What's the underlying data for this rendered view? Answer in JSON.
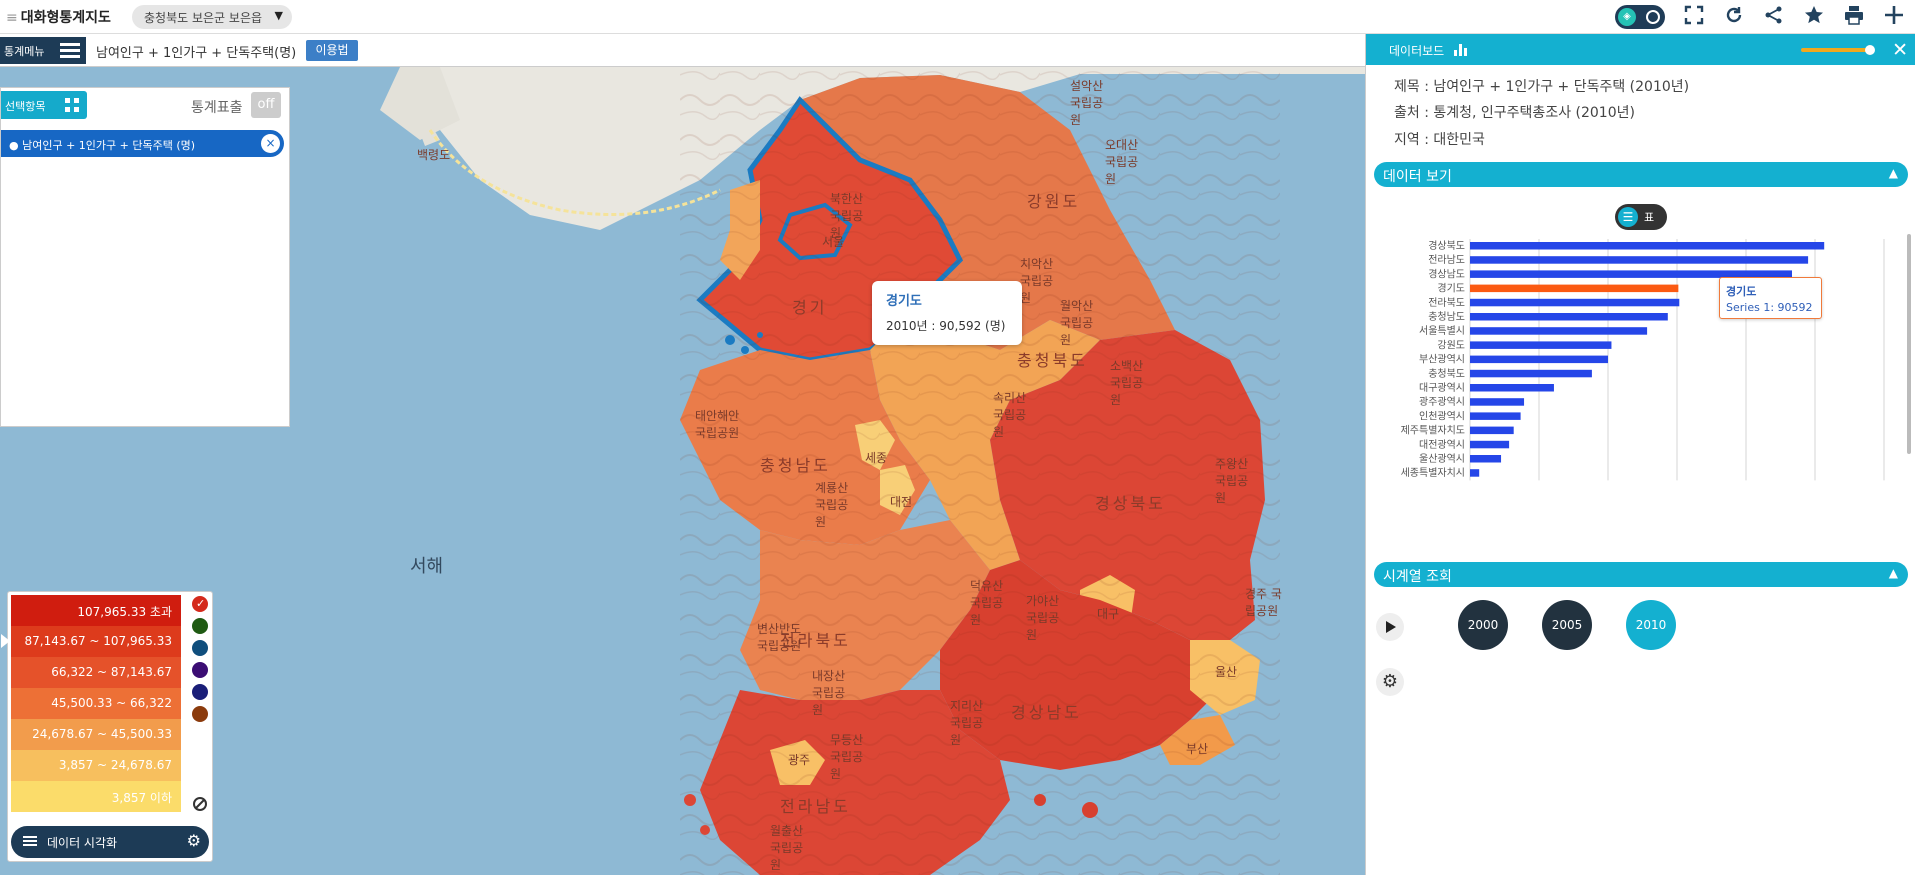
{
  "topbar": {
    "menu_glyph": "≡",
    "brand": "대화형통계지도",
    "region": "충청북도 보은군 보은읍",
    "region_caret": "▼",
    "icons": [
      "3d-toggle-icon",
      "fullscreen-icon",
      "refresh-icon",
      "share-icon",
      "star-icon",
      "print-icon",
      "plus-icon"
    ]
  },
  "subbar": {
    "menu_label": "통계메뉴",
    "title": "남여인구 + 1인가구 + 단독주택(명)",
    "help_label": "이용법"
  },
  "selection": {
    "header": "선택항목",
    "stat_label": "통계표출",
    "toggle_label": "off",
    "item_label": "● 남여인구 + 1인가구 + 단독주택 (명)",
    "remove_glyph": "×"
  },
  "map": {
    "labels": {
      "gangwon": "강원도",
      "chungbuk": "충청북도",
      "chungnam": "충청남도",
      "gyeongbuk": "경상북도",
      "gyeongnam": "경상남도",
      "jeonbuk": "전라북도",
      "jeonnam": "전라남도",
      "gyeonggi": "경기",
      "seoul": "서울",
      "sejong": "세종",
      "daejeon": "대전",
      "daegu": "대구",
      "ulsan": "울산",
      "busan": "부산",
      "gwangju": "광주",
      "baengnyeongdo": "백령도",
      "west_sea": "서해",
      "seoraksan": "설악산 국립공원",
      "odaesan": "오대산 국립공원",
      "bukhansan": "북한산 국립공원",
      "chiaksan": "치악산 국립공원",
      "woraksan": "월악산 국립공원",
      "sobaeksan": "소백산 국립공원",
      "songnisan": "속리산 국립공원",
      "taean": "태안해안 국립공원",
      "gyeryongsan": "계룡산 국립공원",
      "byeonsanbando": "변산반도 국립공원",
      "naejangsan": "내장산 국립공원",
      "mudeungsan": "무등산 국립공원",
      "jirisan": "지리산 국립공원",
      "wolchulsan": "월출산 국립공원",
      "juwangsan": "주왕산 국립공원",
      "gayasan": "가야산 국립공원",
      "gyeongju": "경주 국립공원",
      "deogyusan": "덕유산 국립공원"
    },
    "tooltip": {
      "title": "경기도",
      "value": "2010년 : 90,592 (명)"
    }
  },
  "legend": {
    "rows": [
      {
        "label": "107,965.33 초과",
        "color": "#d01d0f"
      },
      {
        "label": "87,143.67 ~ 107,965.33",
        "color": "#dd3b1c"
      },
      {
        "label": "66,322 ~ 87,143.67",
        "color": "#e5522a"
      },
      {
        "label": "45,500.33 ~ 66,322",
        "color": "#ed7036"
      },
      {
        "label": "24,678.67 ~ 45,500.33",
        "color": "#f29c4c"
      },
      {
        "label": "3,857 ~ 24,678.67",
        "color": "#f7bf5e"
      },
      {
        "label": "3,857 이하",
        "color": "#fbdc6a"
      }
    ],
    "palettes": [
      "#d42a1c",
      "#1f5a13",
      "#0f4e7d",
      "#3b0d73",
      "#1a1e78",
      "#8b3b0d"
    ],
    "viz_label": "데이터 시각화"
  },
  "dashboard": {
    "header": "데이터보드",
    "close_glyph": "✕",
    "slider_level": 1.0,
    "title_line": "제목 : 남여인구 + 1인가구 + 단독주택 (2010년)",
    "source_line": "출처 : 통계청, 인구주택총조사 (2010년)",
    "region_line": "지역 : 대한민국",
    "data_view_label": "데이터 보기",
    "table_toggle_label": "표",
    "timeseries_label": "시계열 조회",
    "collapse_glyph": "▲",
    "years": [
      "2000",
      "2005",
      "2010"
    ],
    "active_year": "2010",
    "chart_tooltip": {
      "title": "경기도",
      "series_label": "Series 1",
      "value": ": 90592"
    }
  },
  "chart_data": {
    "type": "bar",
    "orientation": "horizontal",
    "categories": [
      "경상북도",
      "전라남도",
      "경상남도",
      "경기도",
      "전라북도",
      "충청남도",
      "서울특별시",
      "강원도",
      "부산광역시",
      "충청북도",
      "대구광역시",
      "광주광역시",
      "인천광역시",
      "제주특별자치도",
      "대전광역시",
      "울산광역시",
      "세종특별자치시"
    ],
    "series": [
      {
        "name": "Series 1",
        "values": [
          154000,
          147000,
          140000,
          90592,
          91000,
          86000,
          77000,
          61500,
          60000,
          53000,
          36500,
          23500,
          22000,
          19000,
          17000,
          13500,
          4000
        ],
        "highlight_index": 3,
        "color": "#2546e8",
        "highlight_color": "#fb5a12"
      }
    ],
    "xlim": [
      0,
      180000
    ],
    "grid": true,
    "title": "",
    "xlabel": "",
    "ylabel": ""
  }
}
